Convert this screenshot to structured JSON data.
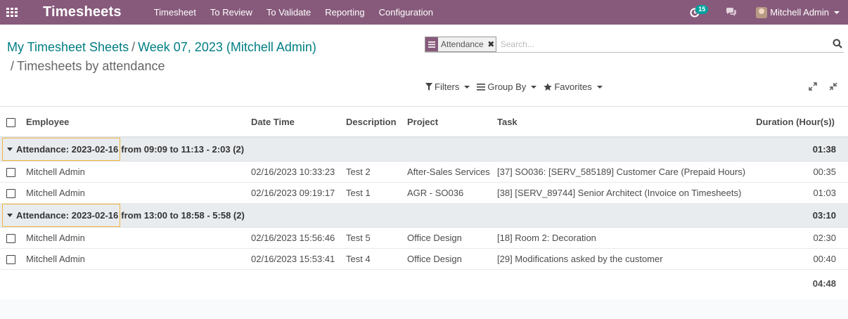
{
  "app": {
    "title": "Timesheets",
    "menu": [
      "Timesheet",
      "To Review",
      "To Validate",
      "Reporting",
      "Configuration"
    ],
    "activity_count": "15",
    "user_name": "Mitchell Admin"
  },
  "breadcrumb": {
    "items": [
      "My Timesheet Sheets",
      "Week 07, 2023 (Mitchell Admin)"
    ],
    "separator": "/",
    "current": "Timesheets by attendance"
  },
  "search": {
    "facet": "Attendance",
    "facet_close": "✖",
    "placeholder": "Search..."
  },
  "filters": {
    "filters_label": "Filters",
    "group_by_label": "Group By",
    "favorites_label": "Favorites"
  },
  "table": {
    "columns": [
      "Employee",
      "Date Time",
      "Description",
      "Project",
      "Task",
      "Duration (Hour(s))"
    ],
    "groups": [
      {
        "label_highlight": "Attendance: 2023-02-16",
        "label_rest": "from 09:09 to 11:13 - 2:03 (2)",
        "total": "01:38",
        "rows": [
          {
            "employee": "Mitchell Admin",
            "datetime": "02/16/2023 10:33:23",
            "description": "Test 2",
            "project": "After-Sales Services",
            "task": "[37] SO036: [SERV_585189] Customer Care (Prepaid Hours)",
            "duration": "00:35"
          },
          {
            "employee": "Mitchell Admin",
            "datetime": "02/16/2023 09:19:17",
            "description": "Test 1",
            "project": "AGR - SO036",
            "task": "[38] [SERV_89744] Senior Architect (Invoice on Timesheets)",
            "duration": "01:03"
          }
        ]
      },
      {
        "label_highlight": "Attendance: 2023-02-16",
        "label_rest": "from 13:00 to 18:58 - 5:58 (2)",
        "total": "03:10",
        "rows": [
          {
            "employee": "Mitchell Admin",
            "datetime": "02/16/2023 15:56:46",
            "description": "Test 5",
            "project": "Office Design",
            "task": "[18] Room 2: Decoration",
            "duration": "02:30"
          },
          {
            "employee": "Mitchell Admin",
            "datetime": "02/16/2023 15:53:41",
            "description": "Test 4",
            "project": "Office Design",
            "task": "[29] Modifications asked by the customer",
            "duration": "00:40"
          }
        ]
      }
    ],
    "grand_total": "04:48"
  },
  "colors": {
    "navbar": "#875a7b",
    "link": "#017e84",
    "highlight_border": "#f0b43a",
    "badge": "#00a09d"
  },
  "icons": [
    "apps-icon",
    "activity-icon",
    "chat-icon",
    "search-icon",
    "filter-icon",
    "group-by-icon",
    "star-icon",
    "expand-icon",
    "collapse-icon"
  ]
}
